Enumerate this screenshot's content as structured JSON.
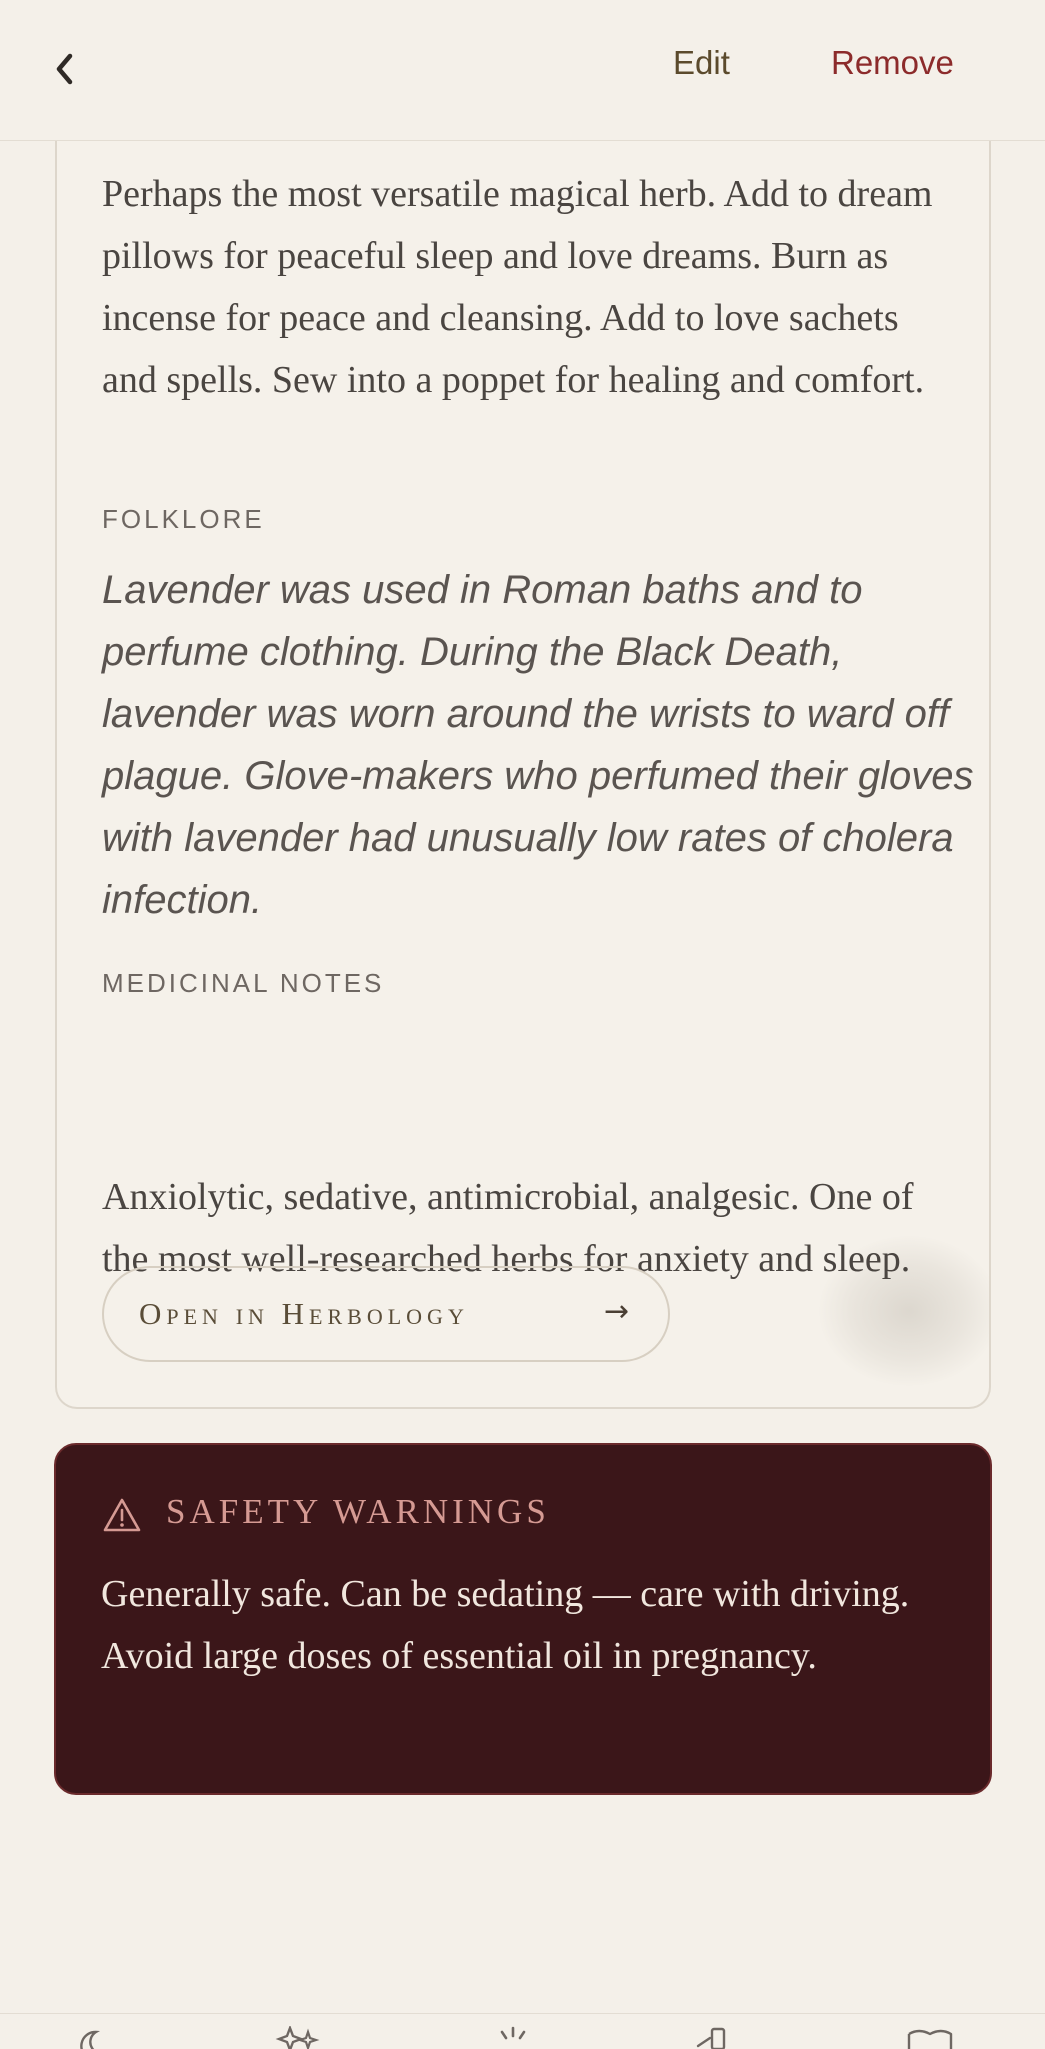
{
  "header": {
    "back_glyph": "❮",
    "edit_label": "Edit",
    "remove_label": "Remove"
  },
  "herb": {
    "magical_uses_text": "Perhaps the most versatile magical herb. Add to dream pillows for peaceful sleep and love dreams. Burn as incense for peace and cleansing. Add to love sachets and spells. Sew into a poppet for healing and comfort.",
    "folklore_label": "FOLKLORE",
    "folklore_text": "Lavender was used in Roman baths and to perfume clothing. During the Black Death, lavender was worn around the wrists to ward off plague. Glove-makers who perfumed their gloves with lavender had unusually low rates of cholera infection.",
    "medicinal_label": "MEDICINAL NOTES",
    "medicinal_text": "Anxiolytic, sedative, antimicrobial, analgesic. One of the most well-researched herbs for anxiety and sleep.",
    "open_button_label": "Open in Herbology",
    "open_button_arrow": "→"
  },
  "safety": {
    "title": "SAFETY WARNINGS",
    "text": "Generally safe. Can be sedating — care with driving. Avoid large doses of essential oil in pregnancy."
  },
  "bottom_nav": {
    "items": [
      "moon-icon",
      "sparkles-icon",
      "sun-icon",
      "garden-icon",
      "book-icon"
    ]
  },
  "colors": {
    "background": "#f4f0e9",
    "accent_red": "#8c2b2b",
    "safety_bg": "#3b1619",
    "safety_title": "#d59a93"
  }
}
